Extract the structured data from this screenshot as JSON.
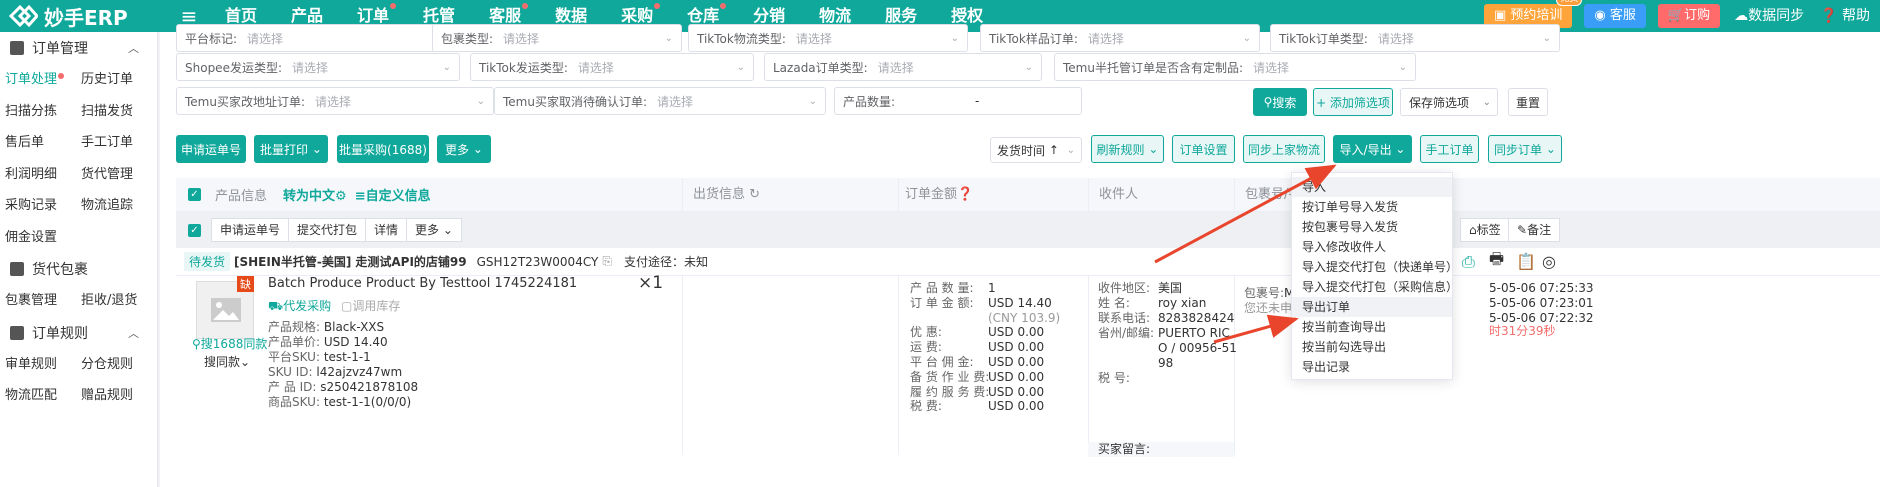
{
  "app": {
    "logo_text": "妙手ERP"
  },
  "nav": [
    "首页",
    "产品",
    "订单",
    "托管",
    "客服",
    "数据",
    "采购",
    "仓库",
    "分销",
    "物流",
    "服务",
    "授权"
  ],
  "nav_dots": [
    false,
    false,
    true,
    false,
    true,
    false,
    true,
    true,
    false,
    false,
    false,
    false
  ],
  "top_right": {
    "training": "预约培训",
    "training_badge": "免费",
    "service": "客服",
    "order": "订购",
    "sync": "数据同步",
    "help": "帮助"
  },
  "sidebar": {
    "groups": [
      {
        "title": "订单管理",
        "items": [
          "订单处理",
          "历史订单",
          "扫描分拣",
          "扫描发货",
          "售后单",
          "手工订单",
          "利润明细",
          "货代管理",
          "采购记录",
          "物流追踪",
          "佣金设置"
        ]
      },
      {
        "title": "货代包裹",
        "items": [
          "包裹管理",
          "拒收/退货"
        ]
      },
      {
        "title": "订单规则",
        "items": [
          "审单规则",
          "分仓规则",
          "物流匹配",
          "赠品规则"
        ]
      }
    ]
  },
  "filters": {
    "row0": [
      {
        "label": "平台标记:",
        "ph": "请选择"
      },
      {
        "label": "包裹类型:",
        "ph": "请选择"
      },
      {
        "label": "TikTok物流类型:",
        "ph": "请选择"
      },
      {
        "label": "TikTok样品订单:",
        "ph": "请选择"
      },
      {
        "label": "TikTok订单类型:",
        "ph": "请选择"
      }
    ],
    "row1": [
      {
        "label": "Shopee发运类型:",
        "ph": "请选择"
      },
      {
        "label": "TikTok发运类型:",
        "ph": "请选择"
      },
      {
        "label": "Lazada订单类型:",
        "ph": "请选择"
      },
      {
        "label": "Temu半托管订单是否含有定制品:",
        "ph": "请选择"
      }
    ],
    "row2": [
      {
        "label": "Temu买家改地址订单:",
        "ph": "请选择"
      },
      {
        "label": "Temu买家取消待确认订单:",
        "ph": "请选择"
      },
      {
        "label": "产品数量:",
        "ph": "-"
      }
    ],
    "search": "搜索",
    "add_filter": "+ 添加筛选项",
    "save_filter": "保存筛选项",
    "reset": "重置"
  },
  "toolbar": {
    "apply_waybill": "申请运单号",
    "batch_print": "批量打印",
    "batch_purchase": "批量采购(1688)",
    "more": "更多",
    "sort": "发货时间",
    "refresh_rules": "刷新规则",
    "order_settings": "订单设置",
    "sync_logistics": "同步上家物流",
    "import_export": "导入/导出",
    "manual_order": "手工订单",
    "sync_order": "同步订单"
  },
  "table": {
    "col_product": "产品信息",
    "to_chinese": "转为中文",
    "custom_info": "自定义信息",
    "col_ship": "出货信息",
    "col_amount": "订单金额",
    "col_receiver": "收件人",
    "col_package": "包裹号/物流"
  },
  "selbar": {
    "apply": "申请运单号",
    "submit": "提交代打包",
    "detail": "详情",
    "more": "更多",
    "tag": "标签",
    "remark": "备注"
  },
  "order": {
    "status": "待发货",
    "shop": "[SHEIN半托管-美国]",
    "shop_name": "走测试API的店铺99",
    "order_no": "GSH12T23W0004CY",
    "pay": "支付途径：未知",
    "product_name": "Batch Produce Product By Testtool 1745224181",
    "qty": "×1",
    "lack": "缺",
    "proxy_purchase": "代发采购",
    "use_stock": "调用库存",
    "search1688": "搜1688同款",
    "search_same": "搜同款",
    "attrs": [
      [
        "产品规格:",
        "Black-XXS"
      ],
      [
        "产品单价:",
        "USD 14.40"
      ],
      [
        "平台SKU:",
        "test-1-1"
      ],
      [
        "SKU  ID:",
        "l42ajzvz47wm"
      ],
      [
        "产  品  ID:",
        "s250421878108"
      ],
      [
        "商品SKU:",
        "test-1-1(0/0/0)"
      ]
    ],
    "amounts": [
      [
        "产 品 数 量:",
        "1"
      ],
      [
        "订 单 金 额:",
        "USD 14.40"
      ],
      [
        "",
        "(CNY 103.9)"
      ],
      [
        "优      惠:",
        "USD 0.00"
      ],
      [
        "运      费:",
        "USD 0.00"
      ],
      [
        "平 台 佣 金:",
        "USD 0.00"
      ],
      [
        "备 货 作 业 费:",
        "USD 0.00"
      ],
      [
        "履 约 服 务 费:",
        "USD 0.00"
      ],
      [
        "税      费:",
        "USD 0.00"
      ]
    ],
    "receiver": [
      [
        "收件地区:",
        "美国"
      ],
      [
        "姓      名:",
        "roy xian"
      ],
      [
        "联系电话:",
        "8283828424"
      ],
      [
        "省州/邮编:",
        "PUERTO RIC"
      ],
      [
        "",
        "O / 00956-51"
      ],
      [
        "",
        "98"
      ],
      [
        "税      号:",
        ""
      ]
    ],
    "buyer_note": "买家留言:",
    "package": [
      [
        "包裹号:",
        "MS2025050"
      ],
      [
        "",
        "您还未申请"
      ]
    ],
    "times": [
      "5-05-06 07:25:33",
      "5-05-06 07:23:01",
      "5-05-06 07:22:32"
    ],
    "countdown": "时31分39秒"
  },
  "dropdown": [
    "导入",
    "按订单号导入发货",
    "按包裹号导入发货",
    "导入修改收件人",
    "导入提交代打包（快递单号）",
    "导入提交代打包（采购信息）",
    "导出订单",
    "按当前查询导出",
    "按当前勾选导出",
    "导出记录"
  ],
  "colors": {
    "brand": "#0fa89b",
    "annotation_arrow": "#e8452c"
  }
}
